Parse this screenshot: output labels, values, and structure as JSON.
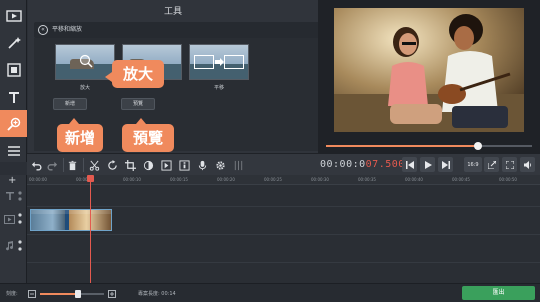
{
  "panel": {
    "title": "工具",
    "subtitle": "平移和縮放"
  },
  "effects": [
    {
      "label": "放大"
    },
    {
      "label": ""
    },
    {
      "label": "平移"
    }
  ],
  "buttons": {
    "add": "新增",
    "preview": "預覽"
  },
  "callouts": {
    "zoom": "放大",
    "add": "新增",
    "preview": "預覽"
  },
  "player": {
    "timecode_main": "00:00:0",
    "timecode_ms": "07.500",
    "progress": 0.74,
    "aspect": "16:9"
  },
  "ruler_ticks": [
    "00:00:00",
    "00:00:05",
    "00:00:10",
    "00:00:15",
    "00:00:20",
    "00:00:25",
    "00:00:30",
    "00:00:35",
    "00:00:40",
    "00:00:45",
    "00:00:50",
    "00:00:55"
  ],
  "bottom": {
    "zoom_label": "刻度:",
    "zoom_level": 0.6,
    "duration_label": "專案長度: 00:14",
    "export_label": "匯出"
  },
  "colors": {
    "accent": "#f08a5d",
    "export": "#3aa05c",
    "playhead": "#e45a4f"
  }
}
